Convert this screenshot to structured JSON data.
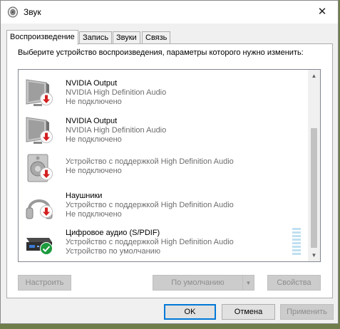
{
  "window": {
    "title": "Звук",
    "close_glyph": "✕",
    "icon": "speaker-icon"
  },
  "tabs": [
    {
      "label": "Воспроизведение",
      "active": true
    },
    {
      "label": "Запись",
      "active": false
    },
    {
      "label": "Звуки",
      "active": false
    },
    {
      "label": "Связь",
      "active": false
    }
  ],
  "instruction": "Выберите устройство воспроизведения, параметры которого нужно изменить:",
  "devices": [
    {
      "name": "NVIDIA Output",
      "description": "NVIDIA High Definition Audio",
      "status": "Не подключено",
      "icon": "monitor-icon",
      "badge": "disconnected-arrow-icon"
    },
    {
      "name": "NVIDIA Output",
      "description": "NVIDIA High Definition Audio",
      "status": "Не подключено",
      "icon": "monitor-icon",
      "badge": "disconnected-arrow-icon"
    },
    {
      "name": "",
      "description": "Устройство с поддержкой High Definition Audio",
      "status": "Не подключено",
      "icon": "speaker-box-icon",
      "badge": "disconnected-arrow-icon"
    },
    {
      "name": "Наушники",
      "description": "Устройство с поддержкой High Definition Audio",
      "status": "Не подключено",
      "icon": "headphones-icon",
      "badge": "disconnected-arrow-icon"
    },
    {
      "name": "Цифровое аудио (S/PDIF)",
      "description": "Устройство с поддержкой High Definition Audio",
      "status": "Устройство по умолчанию",
      "icon": "spdif-receiver-icon",
      "badge": "default-check-icon"
    }
  ],
  "panel_buttons": {
    "configure": "Настроить",
    "set_default": "По умолчанию",
    "properties": "Свойства"
  },
  "dialog_buttons": {
    "ok": "OK",
    "cancel": "Отмена",
    "apply": "Применить"
  },
  "colors": {
    "accent": "#0078d7",
    "disconnected": "#d32020",
    "default_ok": "#1c9a3c"
  }
}
